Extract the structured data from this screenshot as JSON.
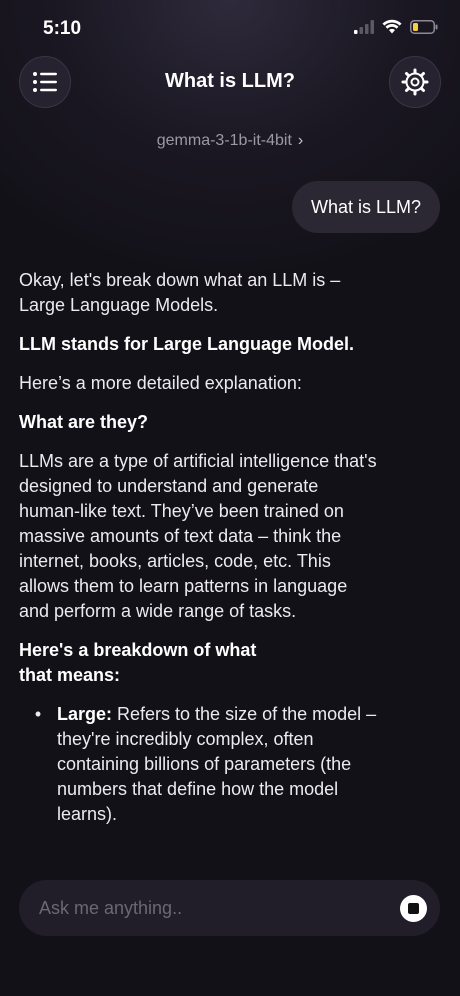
{
  "status_bar": {
    "time": "5:10",
    "icons": [
      "cellular-signal-icon",
      "wifi-icon",
      "battery-low-icon"
    ],
    "battery_color": "#f4d03f"
  },
  "header": {
    "title": "What is LLM?",
    "menu_icon": "list-icon",
    "settings_icon": "gear-icon"
  },
  "model_selector": {
    "label": "gemma-3-1b-it-4bit",
    "chevron": "›"
  },
  "chat": {
    "user_message": "What is LLM?",
    "response": {
      "intro": "Okay, let's break down what an LLM is – Large Language Models.",
      "definition": "LLM stands for Large Language Model.",
      "lead": "Here’s a more detailed explanation:",
      "heading1": "What are they?",
      "paragraph1": "LLMs are a type of artificial intelligence that's designed to understand and generate human-like text. They’ve been trained on massive amounts of text data – think the internet, books, articles, code, etc.  This allows them to learn patterns in language and perform a wide range of tasks.",
      "heading2": "Here's a breakdown of what that means:",
      "bullets": [
        {
          "term": "Large:",
          "text": " Refers to the size of the model – they're incredibly complex, often containing billions of parameters (the numbers that define how the model learns)."
        }
      ]
    }
  },
  "composer": {
    "placeholder": "Ask me anything..",
    "stop_icon": "stop-icon"
  }
}
